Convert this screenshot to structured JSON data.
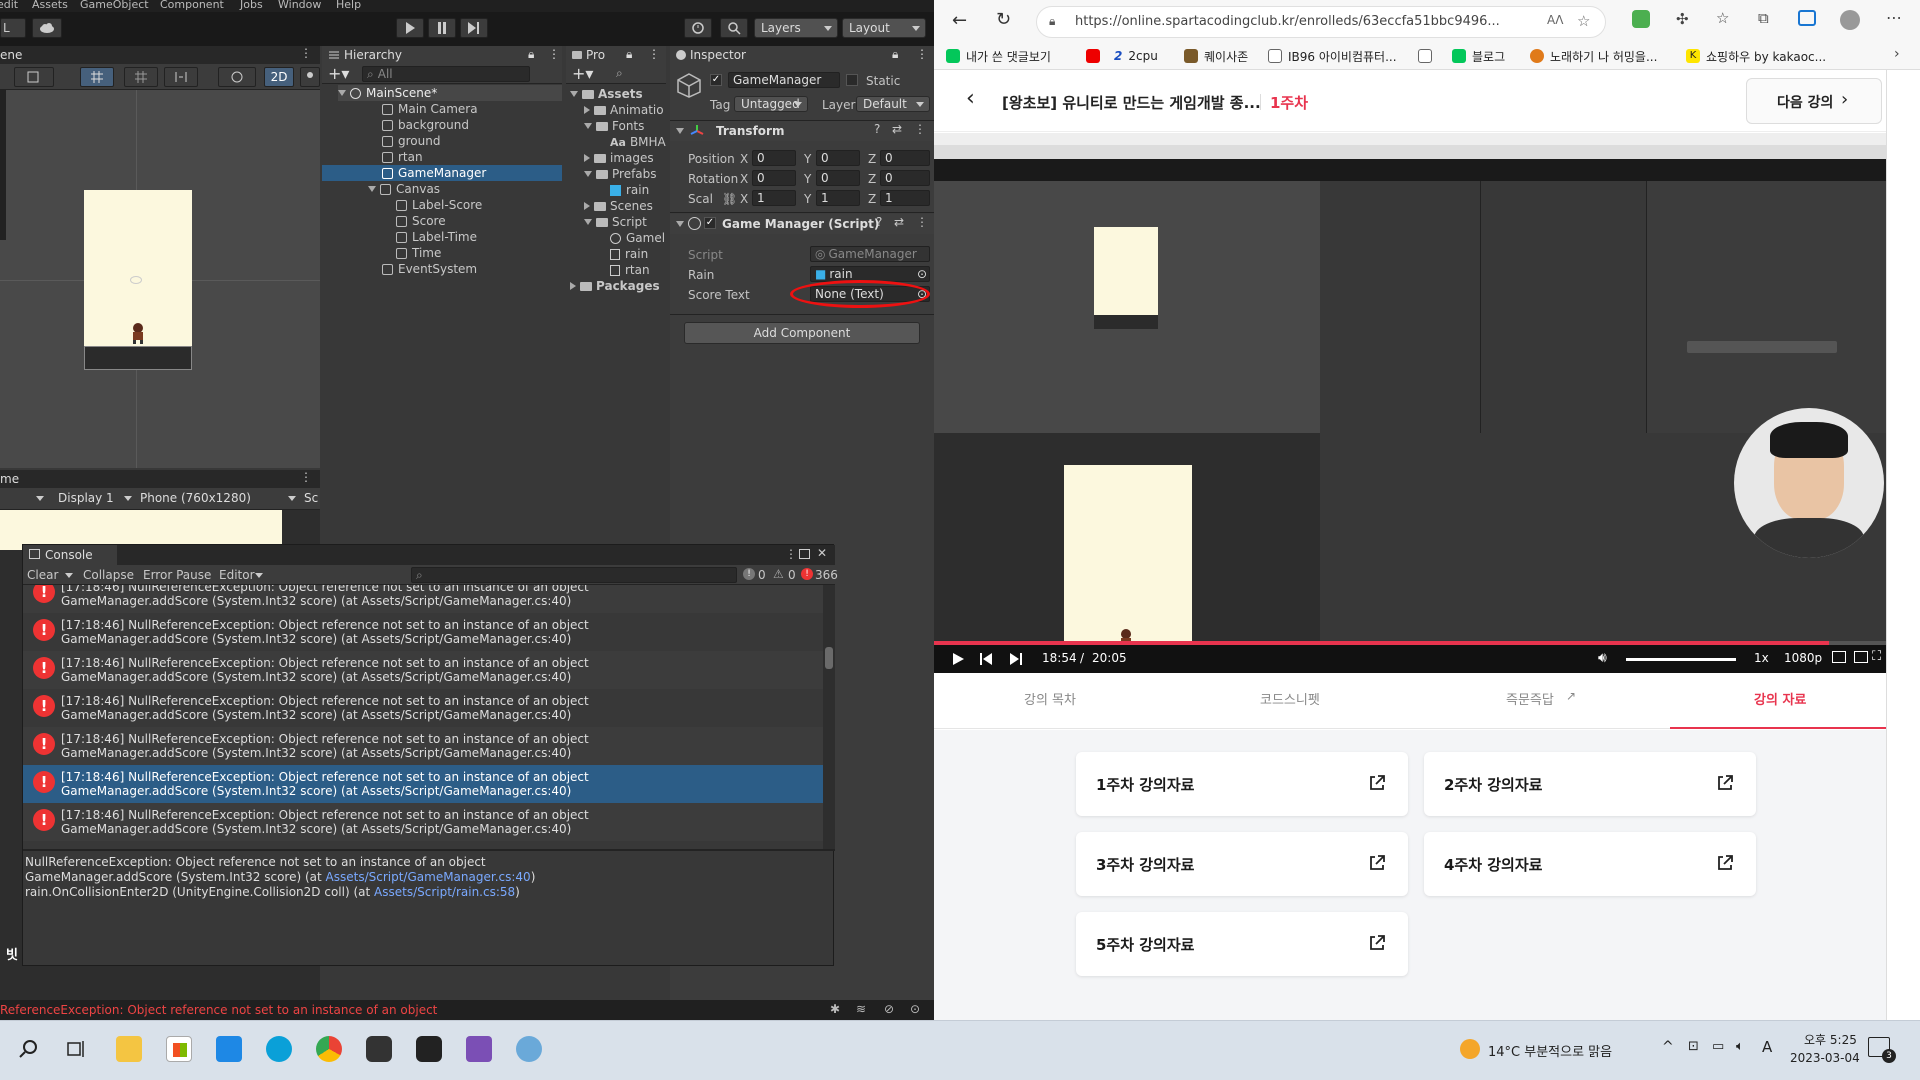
{
  "unity": {
    "menu": [
      "edit",
      "Assets",
      "GameObject",
      "Component",
      "Jobs",
      "Window",
      "Help"
    ],
    "toolbar": {
      "layer_letter": "L",
      "layers": "Layers",
      "layout": "Layout"
    },
    "scene": {
      "tab_partial": "ene",
      "mode_2d": "2D"
    },
    "game": {
      "tab_partial": "me",
      "display": "Display 1",
      "resolution": "Phone (760x1280)",
      "scale_partial": "Sc"
    },
    "hierarchy": {
      "title": "Hierarchy",
      "search_placeholder": "All",
      "scene": "MainScene*",
      "items": [
        "Main Camera",
        "background",
        "ground",
        "rtan",
        "GameManager",
        "Canvas",
        "Label-Score",
        "Score",
        "Label-Time",
        "Time",
        "EventSystem"
      ]
    },
    "project": {
      "title": "Pro",
      "items": [
        "Assets",
        "Animatio",
        "Fonts",
        "BMHA",
        "images",
        "Prefabs",
        "rain",
        "Scenes",
        "Script",
        "Gamel",
        "rain",
        "rtan",
        "Packages"
      ],
      "font_prefix": "Aa"
    },
    "inspector": {
      "title": "Inspector",
      "object_name": "GameManager",
      "static_label": "Static",
      "tag_label": "Tag",
      "tag_value": "Untagged",
      "layer_label": "Layer",
      "layer_value": "Default",
      "transform_title": "Transform",
      "position_label": "Position",
      "rotation_label": "Rotation",
      "scale_label": "Scal",
      "x": "X",
      "y": "Y",
      "z": "Z",
      "pos": [
        "0",
        "0",
        "0"
      ],
      "rot": [
        "0",
        "0",
        "0"
      ],
      "scl": [
        "1",
        "1",
        "1"
      ],
      "component_title": "Game Manager (Script)",
      "script_label": "Script",
      "script_value": "GameManager",
      "rain_label": "Rain",
      "rain_value": "rain",
      "score_text_label": "Score Text",
      "score_text_value": "None (Text)",
      "add_component": "Add Component"
    },
    "console": {
      "title": "Console",
      "clear": "Clear",
      "collapse": "Collapse",
      "error_pause": "Error Pause",
      "editor": "Editor",
      "count_info": "0",
      "count_warn": "0",
      "count_err": "366",
      "row_line1": "[17:18:46] NullReferenceException: Object reference not set to an instance of an object",
      "row_line2": "GameManager.addScore (System.Int32 score) (at Assets/Script/GameManager.cs:40)",
      "detail_line1": "NullReferenceException: Object reference not set to an instance of an object",
      "detail_line2_prefix": "GameManager.addScore (System.Int32 score) (at ",
      "detail_line2_link": "Assets/Script/GameManager.cs:40",
      "detail_line2_suffix": ")",
      "detail_line3_prefix": "rain.OnCollisionEnter2D (UnityEngine.Collision2D coll) (at ",
      "detail_line3_link": "Assets/Script/rain.cs:58",
      "detail_line3_suffix": ")"
    },
    "status_error": "ReferenceException: Object reference not set to an instance of an object",
    "bottom_glyph": "빗"
  },
  "browser": {
    "url": "https://online.spartacodingclub.kr/enrolleds/63eccfa51bbc9496...",
    "bookmarks": [
      "내가 쓴 댓글보기",
      "2cpu",
      "퀘이사존",
      "IB96 아이비컴퓨터...",
      "블로그",
      "노래하기 나 허밍을...",
      "쇼핑하우 by kakaoc..."
    ],
    "lecture_title": "[왕초보] 유니티로 만드는 게임개발 종...",
    "week": "1주차",
    "next_btn": "다음 강의",
    "video": {
      "time_current": "18:54",
      "time_sep": "/",
      "time_total": "20:05",
      "speed": "1x",
      "quality": "1080p"
    },
    "tabs": [
      "강의 목차",
      "코드스니펫",
      "즉문즉답",
      "강의 자료"
    ],
    "materials": [
      "1주차 강의자료",
      "2주차 강의자료",
      "3주차 강의자료",
      "4주차 강의자료",
      "5주차 강의자료"
    ]
  },
  "taskbar": {
    "weather": "14°C  부분적으로 맑음",
    "ime": "A",
    "time": "오후 5:25",
    "date": "2023-03-04",
    "notif": "3"
  }
}
